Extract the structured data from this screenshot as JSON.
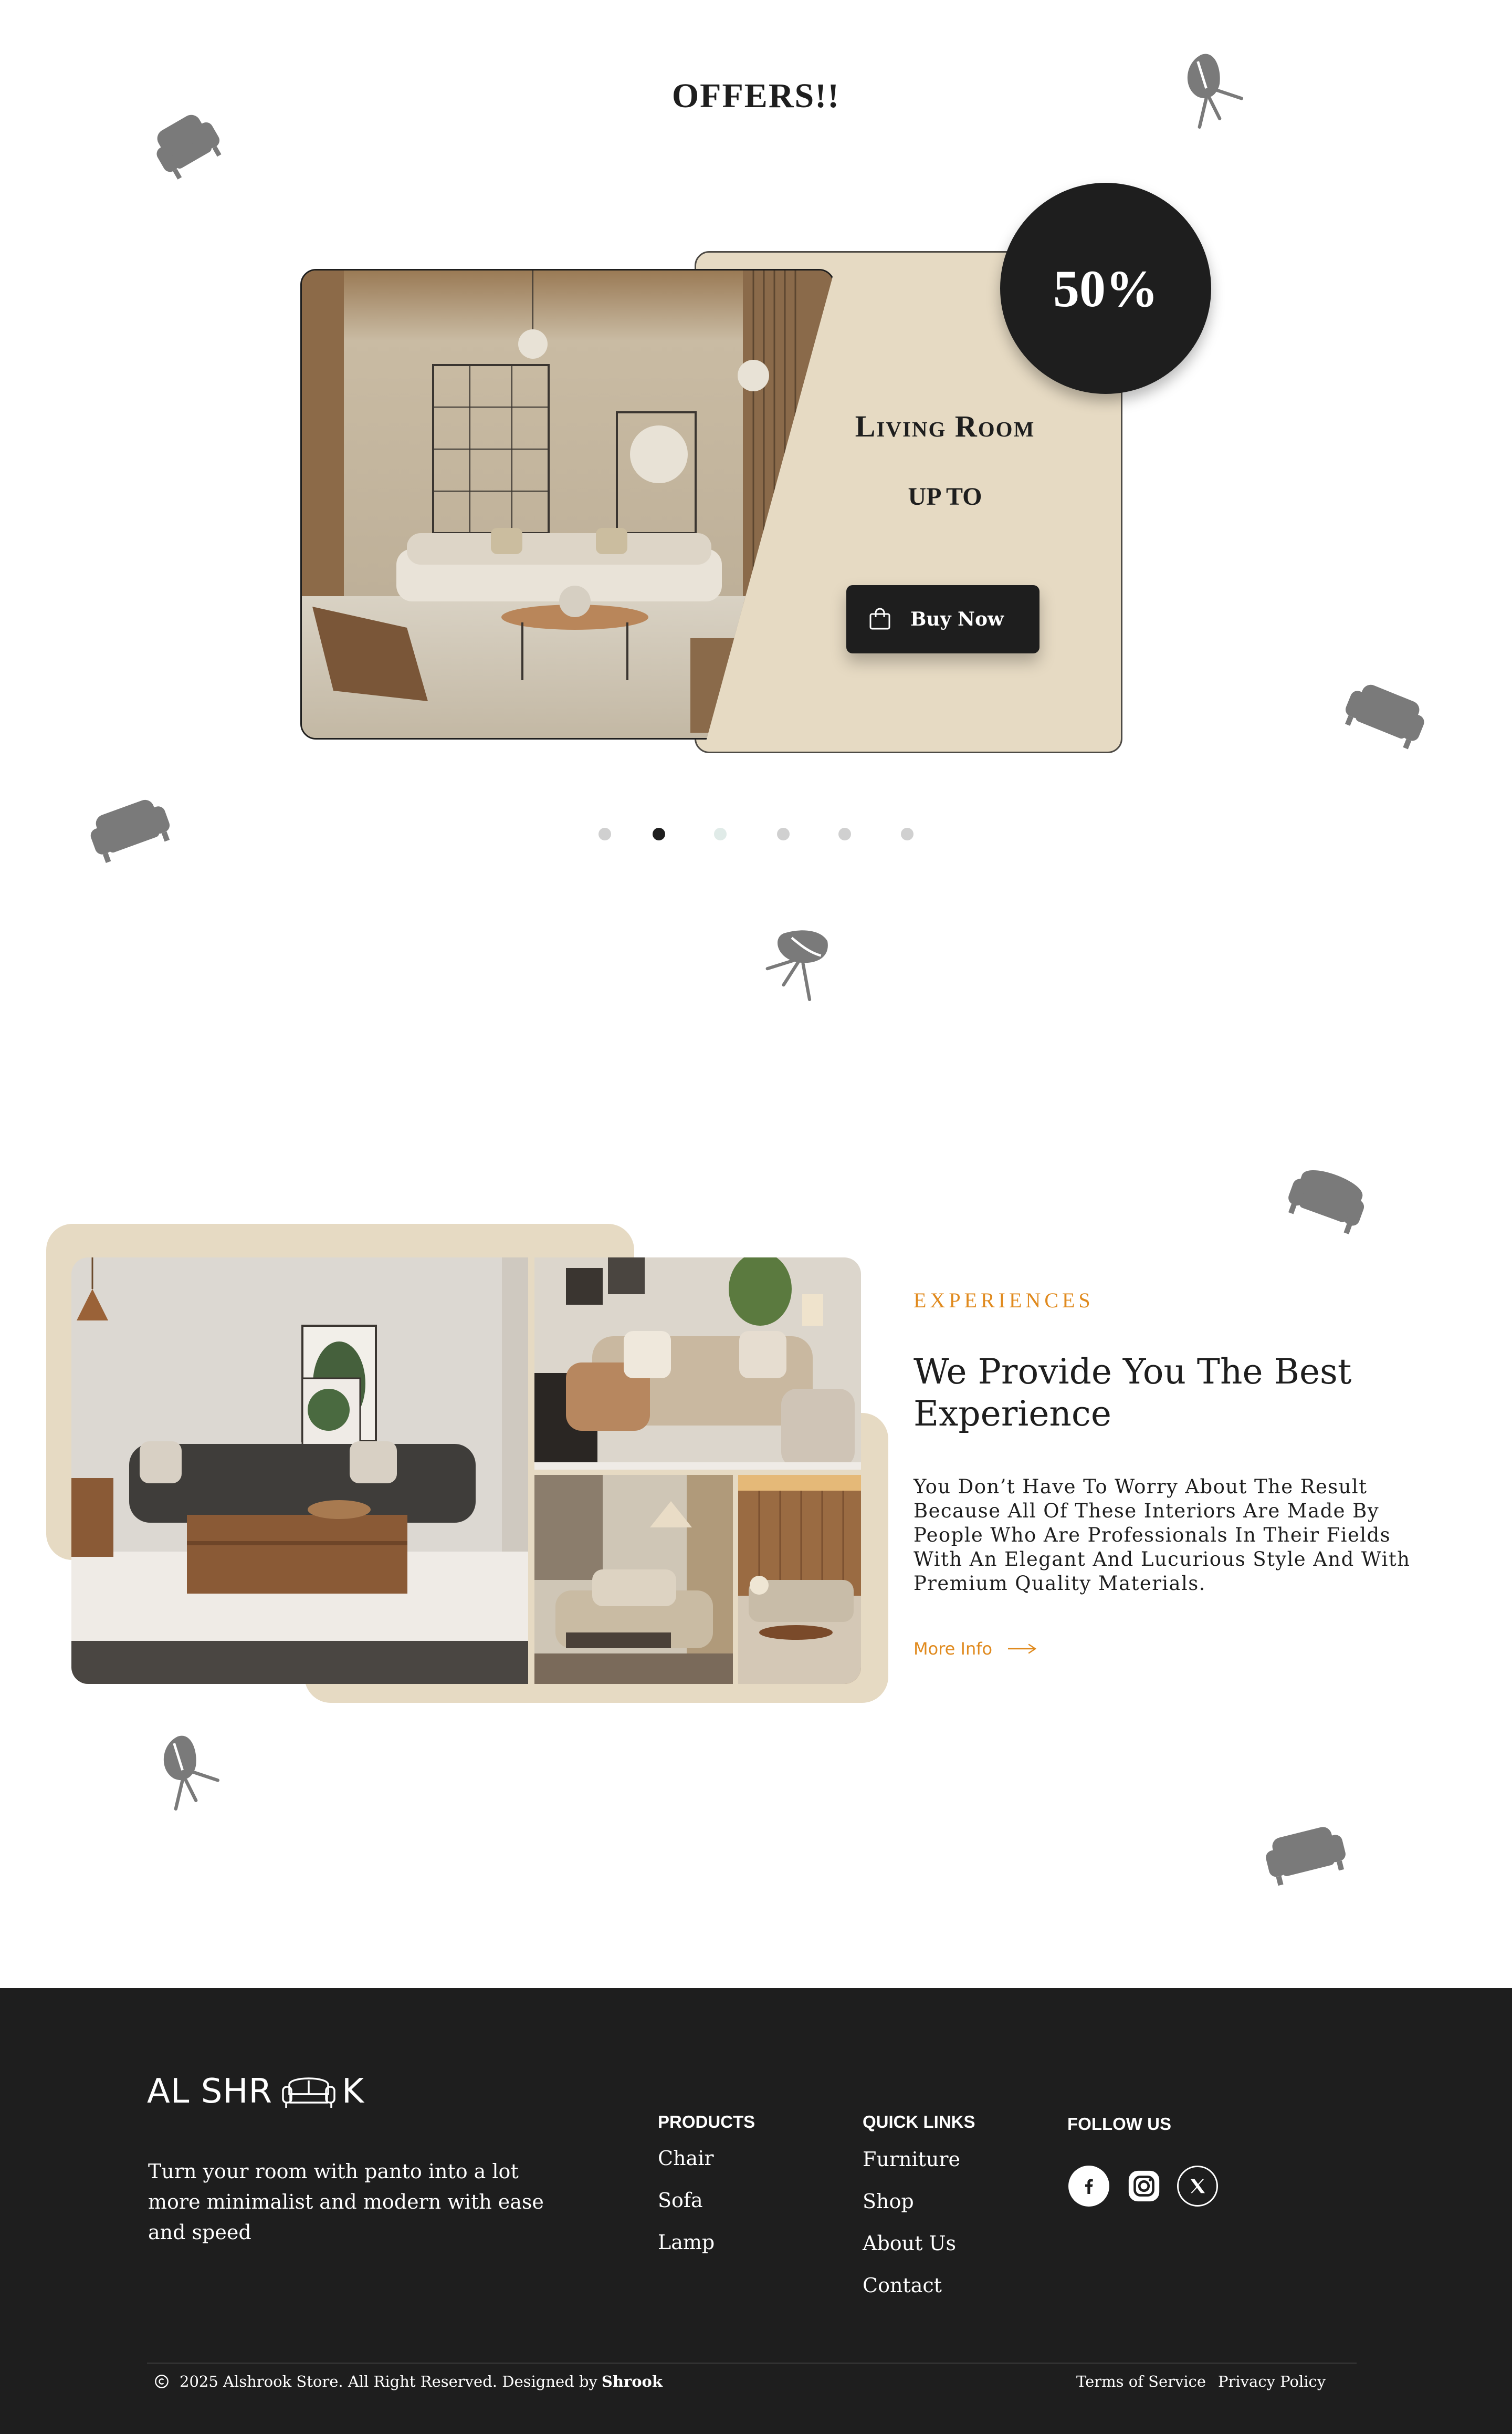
{
  "offers": {
    "title": "OFFERS!!",
    "discount": "50%",
    "category": "Living Room",
    "up_to": "UP TO",
    "buy_label": "Buy Now",
    "carousel_count": 6,
    "carousel_active": 2
  },
  "experiences": {
    "eyebrow": "EXPERIENCES",
    "title": "We Provide You The Best Experience",
    "body": "You Don’t Have To Worry About The Result Because All Of These Interiors Are Made By People Who Are Professionals In Their Fields With An Elegant And Lucurious Style And With Premium Quality Materials.",
    "more_label": "More Info"
  },
  "footer": {
    "logo_left": "AL SHR",
    "logo_right": "K",
    "tagline": "Turn your room with panto into a lot more minimalist and modern with ease and speed",
    "products": {
      "heading": "PRODUCTS",
      "links": [
        "Chair",
        "Sofa",
        "Lamp"
      ]
    },
    "quick_links": {
      "heading": "QUICK LINKS",
      "links": [
        "Furniture",
        "Shop",
        "About Us",
        "Contact"
      ]
    },
    "follow": {
      "heading": "FOLLOW US",
      "icons": [
        "facebook-icon",
        "instagram-icon",
        "x-icon"
      ]
    },
    "copyright": "2025 Alshrook Store. All Right Reserved. Designed by",
    "designer": "Shrook",
    "terms": "Terms of Service",
    "privacy": "Privacy Policy"
  },
  "colors": {
    "dark": "#1e1e1e",
    "beige": "#e6dac3",
    "accent": "#e08a1e",
    "icon_gray": "#7a7a7a"
  }
}
